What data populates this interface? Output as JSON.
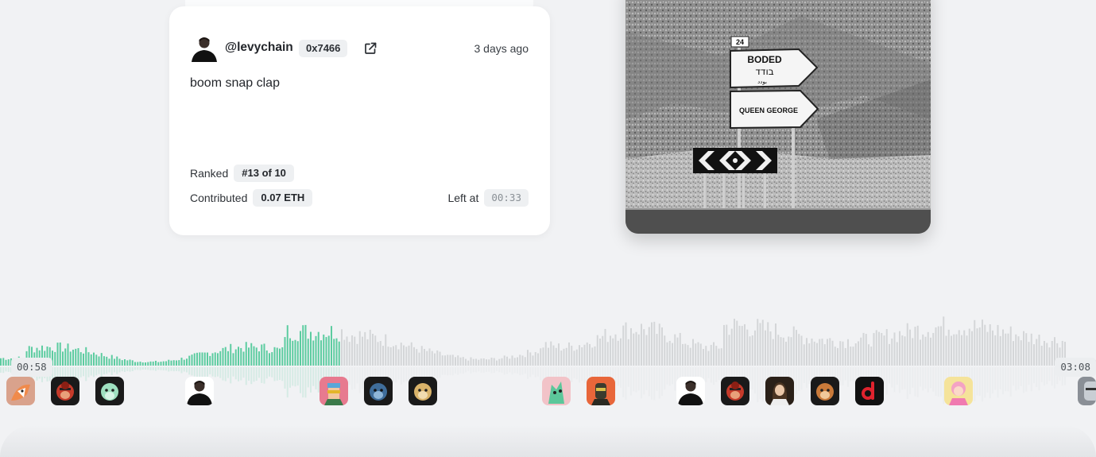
{
  "comment_card": {
    "handle": "@levychain",
    "address": "0x7466",
    "time_ago": "3 days ago",
    "message": "boom snap clap",
    "ranked_label": "Ranked",
    "ranked_value": "#13 of 10",
    "contributed_label": "Contributed",
    "contributed_value": "0.07 ETH",
    "left_at_label": "Left at",
    "left_at_value": "00:33"
  },
  "artwork": {
    "sign_top": "BODED",
    "sign_top_hebrew": "בודד",
    "sign_top_small": "بودد",
    "sign_bottom": "QUEEN GEORGE",
    "sign_number": "24"
  },
  "player": {
    "current_time": "00:58",
    "total_time": "03:08",
    "progress": 0.31,
    "played_color": "#5ccca0",
    "unplayed_color": "#d4d6d8"
  },
  "collectors": [
    {
      "icon": "fox-avatar-icon",
      "bg": "#d9a28c"
    },
    {
      "icon": "red-ape-avatar-icon",
      "bg": "#1a1a1a"
    },
    {
      "icon": "mint-ape-avatar-icon",
      "bg": "#1a1a1a"
    },
    {
      "icon": "man-avatar-icon",
      "bg": "#ffffff"
    },
    {
      "icon": "pink-punk-avatar-icon",
      "bg": "#e77a8f"
    },
    {
      "icon": "blue-ape-avatar-icon",
      "bg": "#1a1a1a"
    },
    {
      "icon": "gold-ape-avatar-icon",
      "bg": "#1a1a1a"
    },
    {
      "icon": "dragon-avatar-icon",
      "bg": "#f2c3c8"
    },
    {
      "icon": "orange-character-avatar-icon",
      "bg": "#e8663a"
    },
    {
      "icon": "man-avatar-icon",
      "bg": "#ffffff"
    },
    {
      "icon": "red-ape-avatar-icon",
      "bg": "#1a1a1a"
    },
    {
      "icon": "woman-avatar-icon",
      "bg": "#2a2018"
    },
    {
      "icon": "brown-ape-avatar-icon",
      "bg": "#1a1a1a"
    },
    {
      "icon": "red-d-logo-icon",
      "bg": "#111111"
    },
    {
      "icon": "blonde-character-avatar-icon",
      "bg": "#f5e39a"
    },
    {
      "icon": "knight-avatar-icon",
      "bg": "#8a8f96"
    }
  ]
}
